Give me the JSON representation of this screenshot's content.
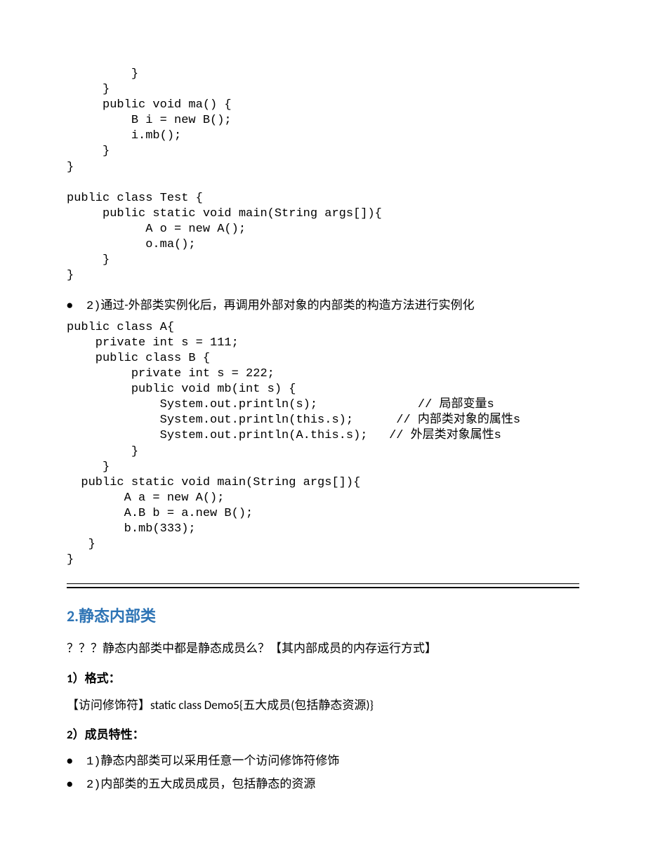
{
  "code1": "         }\n     }\n     public void ma() {\n         B i = new B();\n         i.mb();\n     }\n}\n\npublic class Test {\n     public static void main(String args[]){\n           A o = new A();\n           o.ma();\n     }\n}",
  "bullet1_label": "2)",
  "bullet1_text": "通过-外部类实例化后，再调用外部对象的内部类的构造方法进行实例化",
  "code2": "public class A{\n    private int s = 111;\n    public class B {\n         private int s = 222;\n         public void mb(int s) {\n             System.out.println(s);              // 局部变量s\n             System.out.println(this.s);      // 内部类对象的属性s\n             System.out.println(A.this.s);   // 外层类对象属性s\n         }\n     }\n  public static void main(String args[]){\n        A a = new A();\n        A.B b = a.new B();\n        b.mb(333);\n   }\n}",
  "section_title": "2.静态内部类",
  "para1": "？？？静态内部类中都是静态成员么？【其内部成员的内存运行方式】",
  "sub1": "1）格式：",
  "para2": "【访问修饰符】static class Demo5{五大成员(包括静态资源)}",
  "sub2": "2）成员特性：",
  "bullet2_label": "1)",
  "bullet2_text": "静态内部类可以采用任意一个访问修饰符修饰",
  "bullet3_label": "2)",
  "bullet3_text": "内部类的五大成员成员，包括静态的资源"
}
